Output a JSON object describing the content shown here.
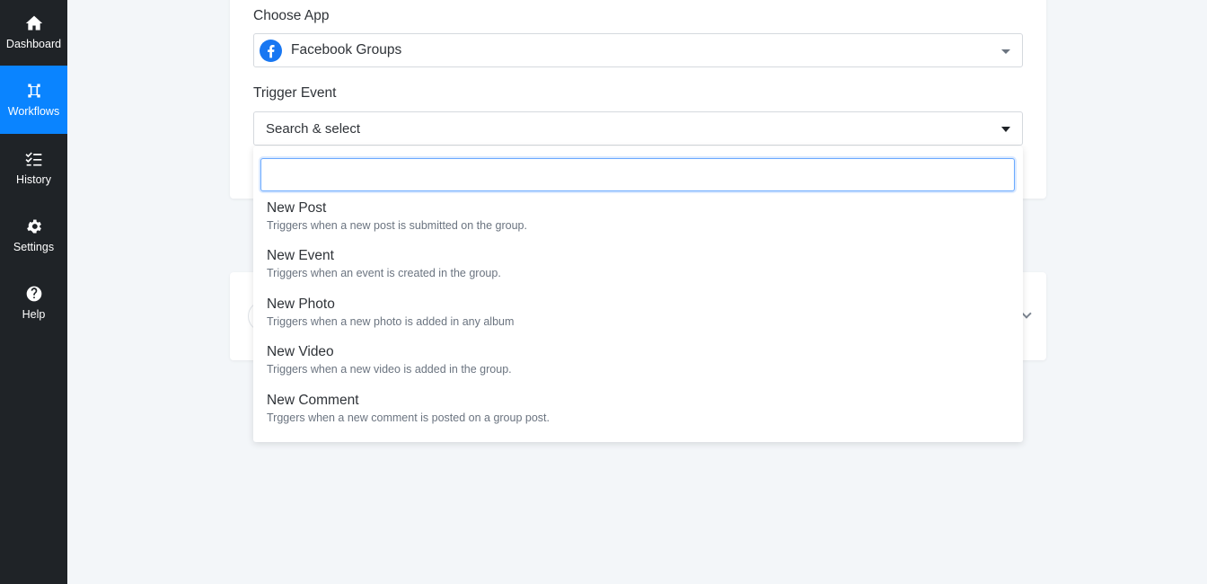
{
  "sidebar": {
    "items": [
      {
        "label": "Dashboard",
        "icon": "home-icon",
        "active": false
      },
      {
        "label": "Workflows",
        "icon": "workflow-icon",
        "active": true
      },
      {
        "label": "History",
        "icon": "checklist-icon",
        "active": false
      },
      {
        "label": "Settings",
        "icon": "gear-icon",
        "active": false
      },
      {
        "label": "Help",
        "icon": "question-icon",
        "active": false
      }
    ]
  },
  "form": {
    "choose_app_label": "Choose App",
    "app_value": "Facebook Groups",
    "app_icon": "facebook-icon",
    "trigger_label": "Trigger Event",
    "trigger_placeholder": "Search & select"
  },
  "dropdown": {
    "search_value": "",
    "options": [
      {
        "title": "New Post",
        "desc": "Triggers when a new post is submitted on the group."
      },
      {
        "title": "New Event",
        "desc": "Triggers when an event is created in the group."
      },
      {
        "title": "New Photo",
        "desc": "Triggers when a new photo is added in any album"
      },
      {
        "title": "New Video",
        "desc": "Triggers when a new video is added in the group."
      },
      {
        "title": "New Comment",
        "desc": "Trggers when a new comment is posted on a group post."
      }
    ]
  },
  "colors": {
    "sidebar_bg": "#1f2327",
    "accent": "#0a84ff",
    "facebook_blue": "#1877f2",
    "page_bg": "#f3f6f9"
  }
}
